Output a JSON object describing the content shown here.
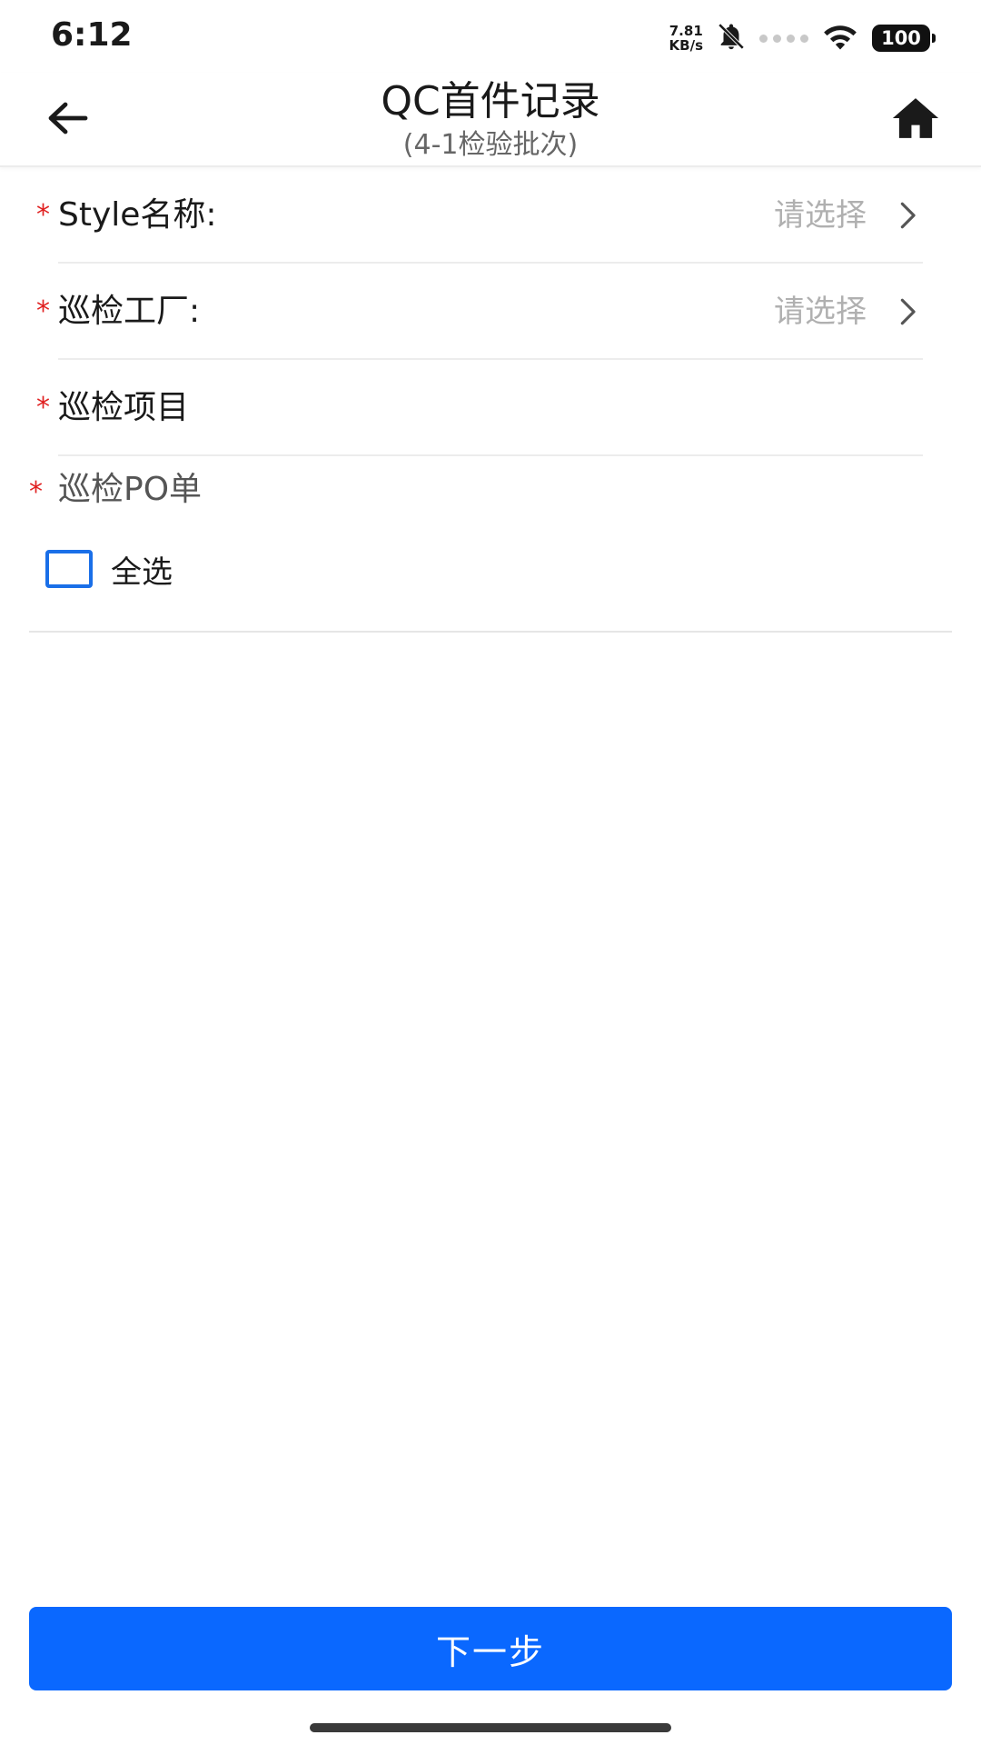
{
  "status_bar": {
    "time": "6:12",
    "net_speed_value": "7.81",
    "net_speed_unit": "KB/s",
    "battery": "100"
  },
  "header": {
    "title": "QC首件记录",
    "subtitle": "(4-1检验批次)"
  },
  "form": {
    "required_mark": "*",
    "style_name": {
      "label": "Style名称:",
      "placeholder": "请选择"
    },
    "factory": {
      "label": "巡检工厂:",
      "placeholder": "请选择"
    },
    "project": {
      "label": "巡检项目"
    },
    "po": {
      "label": "巡检PO单",
      "select_all_label": "全选"
    }
  },
  "footer": {
    "next_label": "下一步"
  },
  "colors": {
    "primary": "#0a68ff",
    "checkbox_border": "#1a6fe8",
    "required": "#e02020",
    "placeholder": "#b0b0b0"
  }
}
